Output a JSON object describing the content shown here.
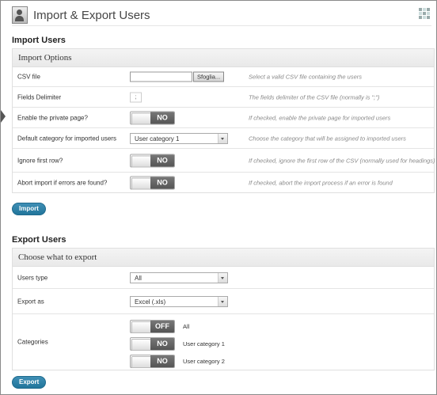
{
  "header": {
    "title": "Import & Export Users",
    "user_icon": "user-icon",
    "grid_icon": "grid-icon"
  },
  "import": {
    "section_title": "Import Users",
    "panel_title": "Import Options",
    "rows": [
      {
        "label": "CSV file",
        "browse_label": "Sfoglia...",
        "description": "Select a valid CSV file containing the users"
      },
      {
        "label": "Fields Delimiter",
        "value": ";",
        "description": "The fields delimiter of the CSV file (normally is \";\")"
      },
      {
        "label": "Enable the private page?",
        "toggle": "NO",
        "description": "If checked, enable the private page for imported users"
      },
      {
        "label": "Default category for imported users",
        "selected": "User category 1",
        "description": "Choose the category that will be assigned to imported users"
      },
      {
        "label": "Ignore first row?",
        "toggle": "NO",
        "description": "If checked, ignore the first row of the CSV (normally used for headings)"
      },
      {
        "label": "Abort import if errors are found?",
        "toggle": "NO",
        "description": "If checked, abort the import process if an error is found"
      }
    ],
    "button_label": "Import"
  },
  "export": {
    "section_title": "Export Users",
    "panel_title": "Choose what to export",
    "users_type": {
      "label": "Users type",
      "selected": "All"
    },
    "export_as": {
      "label": "Export as",
      "selected": "Excel (.xls)"
    },
    "categories": {
      "label": "Categories",
      "items": [
        {
          "toggle": "OFF",
          "name": "All"
        },
        {
          "toggle": "NO",
          "name": "User category 1"
        },
        {
          "toggle": "NO",
          "name": "User category 2"
        }
      ]
    },
    "button_label": "Export"
  }
}
